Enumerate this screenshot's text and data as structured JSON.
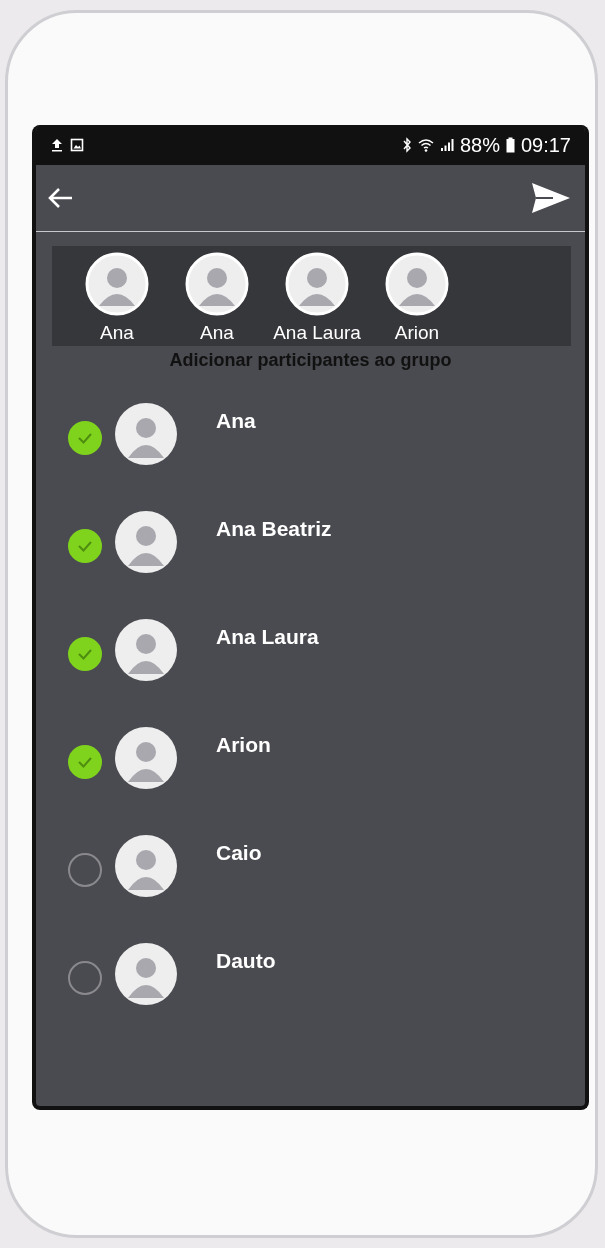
{
  "status_bar": {
    "battery": "88%",
    "time": "09:17"
  },
  "selected_participants": [
    {
      "name": "Ana"
    },
    {
      "name": "Ana"
    },
    {
      "name": "Ana Laura"
    },
    {
      "name": "Arion"
    }
  ],
  "section_title": "Adicionar participantes ao grupo",
  "contacts": [
    {
      "name": "Ana",
      "selected": true
    },
    {
      "name": "Ana Beatriz",
      "selected": true
    },
    {
      "name": "Ana Laura",
      "selected": true
    },
    {
      "name": "Arion",
      "selected": true
    },
    {
      "name": "Caio",
      "selected": false
    },
    {
      "name": "Dauto",
      "selected": false
    }
  ]
}
